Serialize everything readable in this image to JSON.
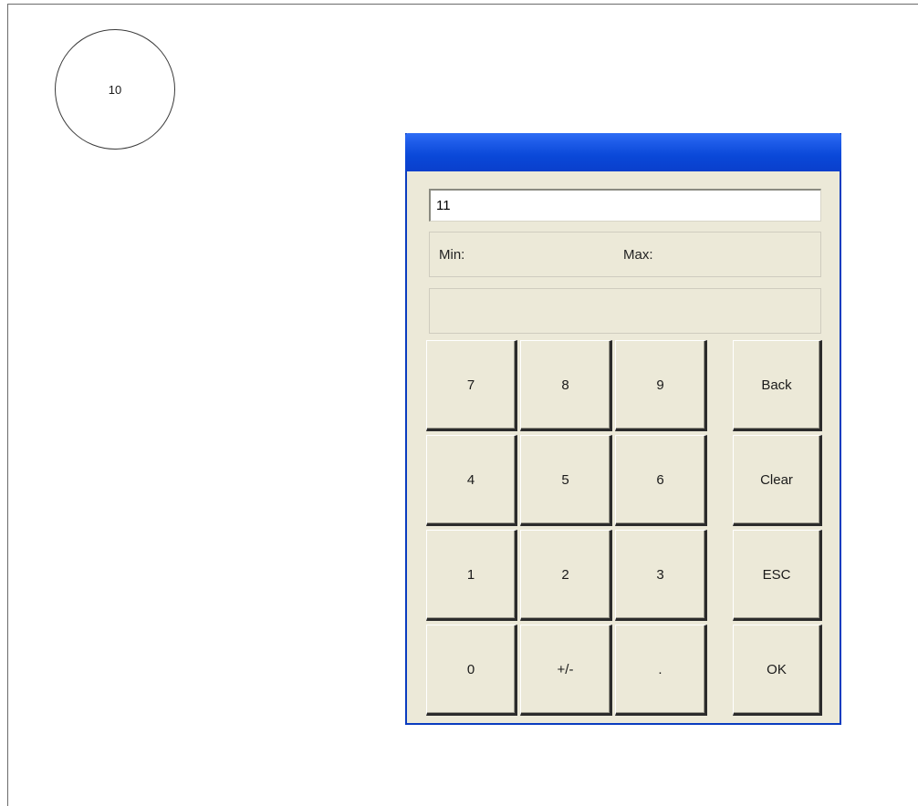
{
  "canvas": {
    "circle_label": "10"
  },
  "dialog": {
    "title": "",
    "input_value": "11",
    "min_label": "Min:",
    "max_label": "Max:",
    "message": "",
    "keys": {
      "k7": "7",
      "k8": "8",
      "k9": "9",
      "back": "Back",
      "k4": "4",
      "k5": "5",
      "k6": "6",
      "clear": "Clear",
      "k1": "1",
      "k2": "2",
      "k3": "3",
      "esc": "ESC",
      "k0": "0",
      "sign": "+/-",
      "dot": ".",
      "ok": "OK"
    }
  },
  "colors": {
    "titlebar": "#0a48d8",
    "dialog_bg": "#ece9d8",
    "dialog_border": "#0a3cbf"
  }
}
